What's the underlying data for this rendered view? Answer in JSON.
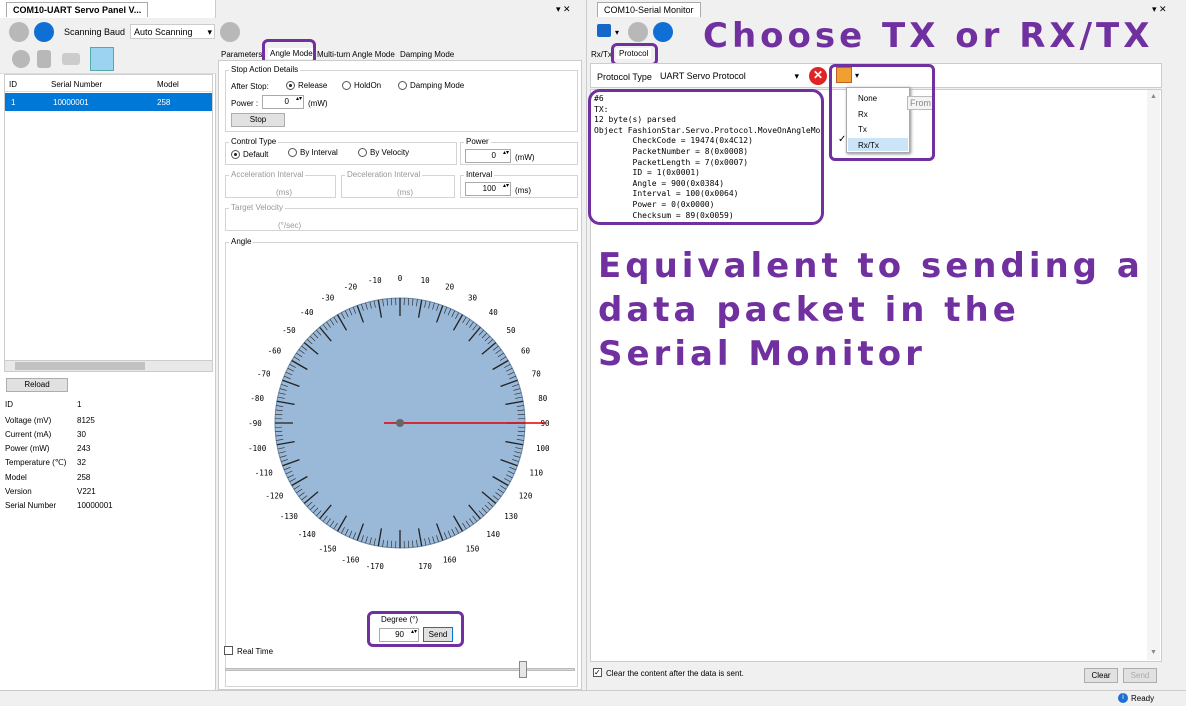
{
  "left": {
    "title": "COM10-UART Servo Panel V...",
    "scan_label": "Scanning Baud",
    "scan_value": "Auto Scanning",
    "table": {
      "headers": [
        "ID",
        "Serial Number",
        "Model"
      ],
      "row": [
        "1",
        "10000001",
        "258"
      ]
    },
    "reload": "Reload",
    "info": [
      [
        "ID",
        "1"
      ],
      [
        "Voltage (mV)",
        "8125"
      ],
      [
        "Current (mA)",
        "30"
      ],
      [
        "Power (mW)",
        "243"
      ],
      [
        "Temperature (℃)",
        "32"
      ],
      [
        "Model",
        "258"
      ],
      [
        "Version",
        "V221"
      ],
      [
        "Serial Number",
        "10000001"
      ]
    ]
  },
  "mid": {
    "tabs": [
      "Parameters",
      "Angle Mode",
      "Multi-turn Angle Mode",
      "Damping Mode"
    ],
    "stop": {
      "group": "Stop Action Details",
      "after": "After Stop:",
      "opts": [
        "Release",
        "HoldOn",
        "Damping Mode"
      ],
      "power": "Power :",
      "power_val": "0",
      "unit": "(mW)",
      "btn": "Stop"
    },
    "control": {
      "group": "Control Type",
      "opts": [
        "Default",
        "By Interval",
        "By Velocity"
      ]
    },
    "power": {
      "group": "Power",
      "val": "0",
      "unit": "(mW)"
    },
    "accel": {
      "group": "Acceleration Interval",
      "unit": "(ms)"
    },
    "decel": {
      "group": "Deceleration Interval",
      "unit": "(ms)"
    },
    "interval": {
      "group": "Interval",
      "val": "100",
      "unit": "(ms)"
    },
    "velocity": {
      "group": "Target Velocity",
      "unit": "(°/sec)"
    },
    "angle": {
      "group": "Angle",
      "degree": "Degree (°)",
      "value": "90",
      "send": "Send",
      "realtime": "Real Time",
      "slider": 0.85
    }
  },
  "right": {
    "title": "COM10-Serial Monitor",
    "tabs": [
      "Rx/Tx",
      "Protocol"
    ],
    "ptype": "Protocol Type",
    "pvalue": "UART Servo Protocol",
    "menu": [
      "None",
      "Rx",
      "Tx",
      "Rx/Tx"
    ],
    "from": "From",
    "log": [
      "#6",
      "TX:",
      "12 byte(s) parsed",
      "Object FashionStar.Servo.Protocol.MoveOnAngleMo",
      "        CheckCode = 19474(0x4C12)",
      "        PacketNumber = 8(0x0008)",
      "        PacketLength = 7(0x0007)",
      "        ID = 1(0x0001)",
      "        Angle = 900(0x0384)",
      "        Interval = 100(0x0064)",
      "        Power = 0(0x0000)",
      "        Checksum = 89(0x0059)"
    ],
    "clear_cb": "Clear the content after the data is sent.",
    "clear": "Clear",
    "send": "Send",
    "status": "Ready"
  },
  "annotations": {
    "top": "Choose TX or RX/TX",
    "mid": [
      "Equivalent to sending a",
      "data packet in the",
      "Serial Monitor"
    ]
  },
  "colors": {
    "accent": "#7030a0",
    "dial": "#9ab8d8",
    "needle": "#e00000",
    "select": "#0078d7"
  }
}
